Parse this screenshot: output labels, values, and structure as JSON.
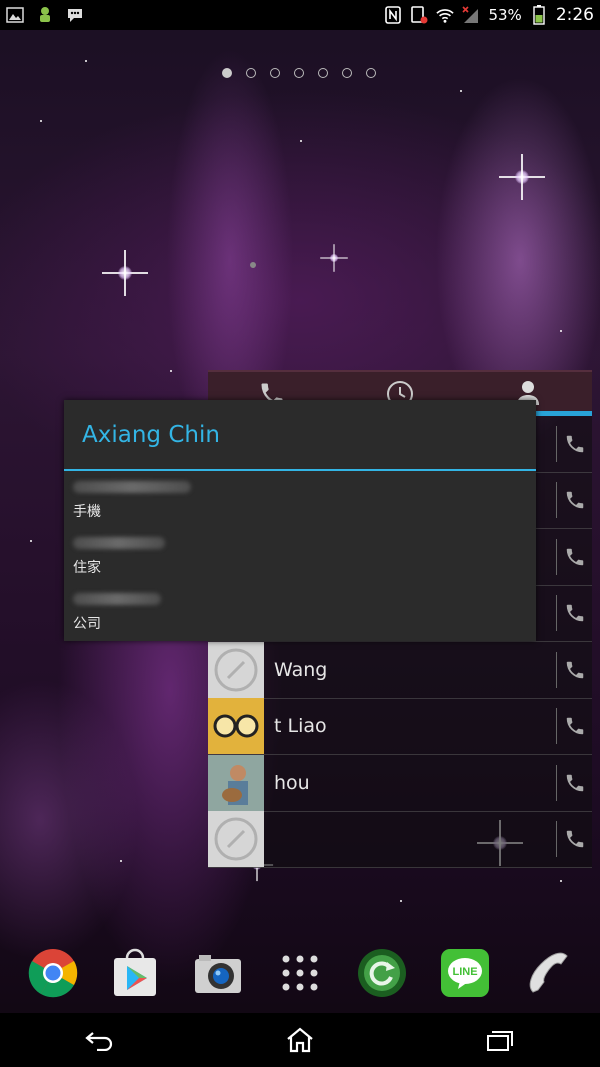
{
  "status_bar": {
    "battery_percent": "53%",
    "time": "2:26",
    "left_icons": [
      "image-notification-icon",
      "droid-notification-icon",
      "bbm-notification-icon"
    ],
    "right_icons": [
      "nfc-icon",
      "sim-blocked-icon",
      "wifi-icon",
      "signal-icon",
      "battery-icon"
    ]
  },
  "home": {
    "page_count": 7,
    "active_page": 0
  },
  "contacts_widget": {
    "tabs": [
      "phone-tab-icon",
      "recent-calls-tab-icon",
      "contacts-tab-icon"
    ],
    "active_tab": 2,
    "rows": [
      {
        "name": "",
        "thumb": "default"
      },
      {
        "name": "",
        "thumb": "default"
      },
      {
        "name": "",
        "thumb": "default"
      },
      {
        "name": "",
        "thumb": "default"
      },
      {
        "name": "Wang",
        "thumb": "default"
      },
      {
        "name": "t Liao",
        "thumb": "glasses"
      },
      {
        "name": "hou",
        "thumb": "photo"
      },
      {
        "name": "",
        "thumb": "default"
      }
    ]
  },
  "dialog": {
    "title": "Axiang Chin",
    "items": [
      {
        "label": "手機"
      },
      {
        "label": "住家"
      },
      {
        "label": "公司"
      }
    ]
  },
  "dock": {
    "apps": [
      "chrome-icon",
      "play-store-icon",
      "camera-icon",
      "app-drawer-icon",
      "update-icon",
      "line-icon",
      "phone-icon"
    ],
    "line_label": "LINE"
  },
  "nav_bar": {
    "buttons": [
      "back-icon",
      "home-icon",
      "recents-icon"
    ]
  },
  "colors": {
    "accent": "#33b5e5",
    "dialog_bg": "#2b2b2b"
  }
}
